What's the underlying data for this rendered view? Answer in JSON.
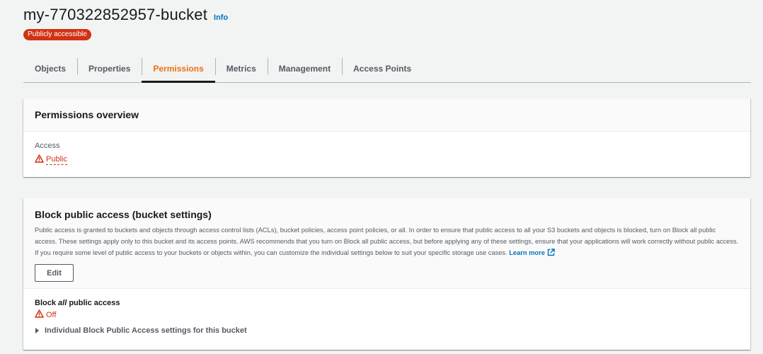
{
  "header": {
    "title": "my-770322852957-bucket",
    "info_label": "Info",
    "badge": "Publicly accessible"
  },
  "tabs": [
    {
      "label": "Objects",
      "active": false
    },
    {
      "label": "Properties",
      "active": false
    },
    {
      "label": "Permissions",
      "active": true
    },
    {
      "label": "Metrics",
      "active": false
    },
    {
      "label": "Management",
      "active": false
    },
    {
      "label": "Access Points",
      "active": false
    }
  ],
  "permissions_overview": {
    "title": "Permissions overview",
    "access_label": "Access",
    "access_value": "Public",
    "access_icon": "warning-icon"
  },
  "block_public_access": {
    "title": "Block public access (bucket settings)",
    "description": "Public access is granted to buckets and objects through access control lists (ACLs), bucket policies, access point policies, or all. In order to ensure that public access to all your S3 buckets and objects is blocked, turn on Block all public access. These settings apply only to this bucket and its access points. AWS recommends that you turn on Block all public access, but before applying any of these settings, ensure that your applications will work correctly without public access. If you require some level of public access to your buckets or objects within, you can customize the individual settings below to suit your specific storage use cases.",
    "learn_more": "Learn more",
    "edit_label": "Edit",
    "block_label_prefix": "Block",
    "block_label_emphasis": "all",
    "block_label_suffix": "public access",
    "block_status": "Off",
    "expand_label": "Individual Block Public Access settings for this bucket"
  },
  "colors": {
    "accent": "#ec7211",
    "danger": "#d13212",
    "link": "#0073bb"
  }
}
